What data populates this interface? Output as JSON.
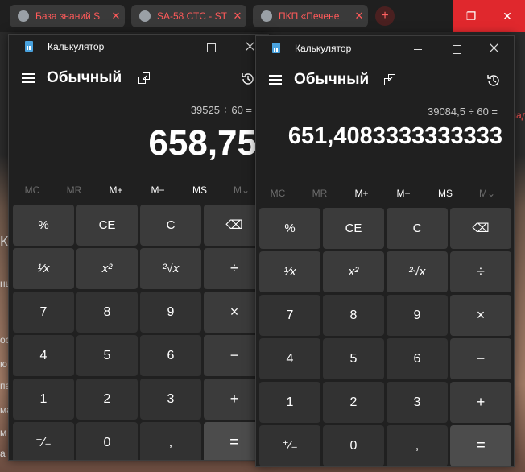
{
  "browser": {
    "tabs": [
      {
        "title": "База знаний S",
        "close": "✕"
      },
      {
        "title": "SA-58 СТС - ST",
        "close": "✕"
      },
      {
        "title": "ПКП «Печене",
        "close": "✕"
      }
    ],
    "new_tab": "+",
    "restore_glyph": "❐",
    "close_glyph": "✕"
  },
  "background_page": {
    "left_edge_texts": [
      "К",
      "ны",
      "ос",
      "ю",
      "па",
      "ма",
      "м",
      "а"
    ],
    "right_edge_text": "лад"
  },
  "calculators": [
    {
      "window_title": "Калькулятор",
      "mode": "Обычный",
      "expression": "39525 ÷ 60 =",
      "result": "658,75",
      "memory": [
        "MC",
        "MR",
        "M+",
        "M−",
        "MS",
        "M⌄"
      ],
      "keys": [
        [
          "%",
          "CE",
          "C",
          "⌫"
        ],
        [
          "¹⁄x",
          "x²",
          "²√x",
          "÷"
        ],
        [
          "7",
          "8",
          "9",
          "×"
        ],
        [
          "4",
          "5",
          "6",
          "−"
        ],
        [
          "1",
          "2",
          "3",
          "+"
        ],
        [
          "⁺⁄₋",
          "0",
          ",",
          "="
        ]
      ]
    },
    {
      "window_title": "Калькулятор",
      "mode": "Обычный",
      "expression": "39084,5 ÷ 60 =",
      "result": "651,4083333333333",
      "memory": [
        "MC",
        "MR",
        "M+",
        "M−",
        "MS",
        "M⌄"
      ],
      "keys": [
        [
          "%",
          "CE",
          "C",
          "⌫"
        ],
        [
          "¹⁄x",
          "x²",
          "²√x",
          "÷"
        ],
        [
          "7",
          "8",
          "9",
          "×"
        ],
        [
          "4",
          "5",
          "6",
          "−"
        ],
        [
          "1",
          "2",
          "3",
          "+"
        ],
        [
          "⁺⁄₋",
          "0",
          ",",
          "="
        ]
      ]
    }
  ]
}
